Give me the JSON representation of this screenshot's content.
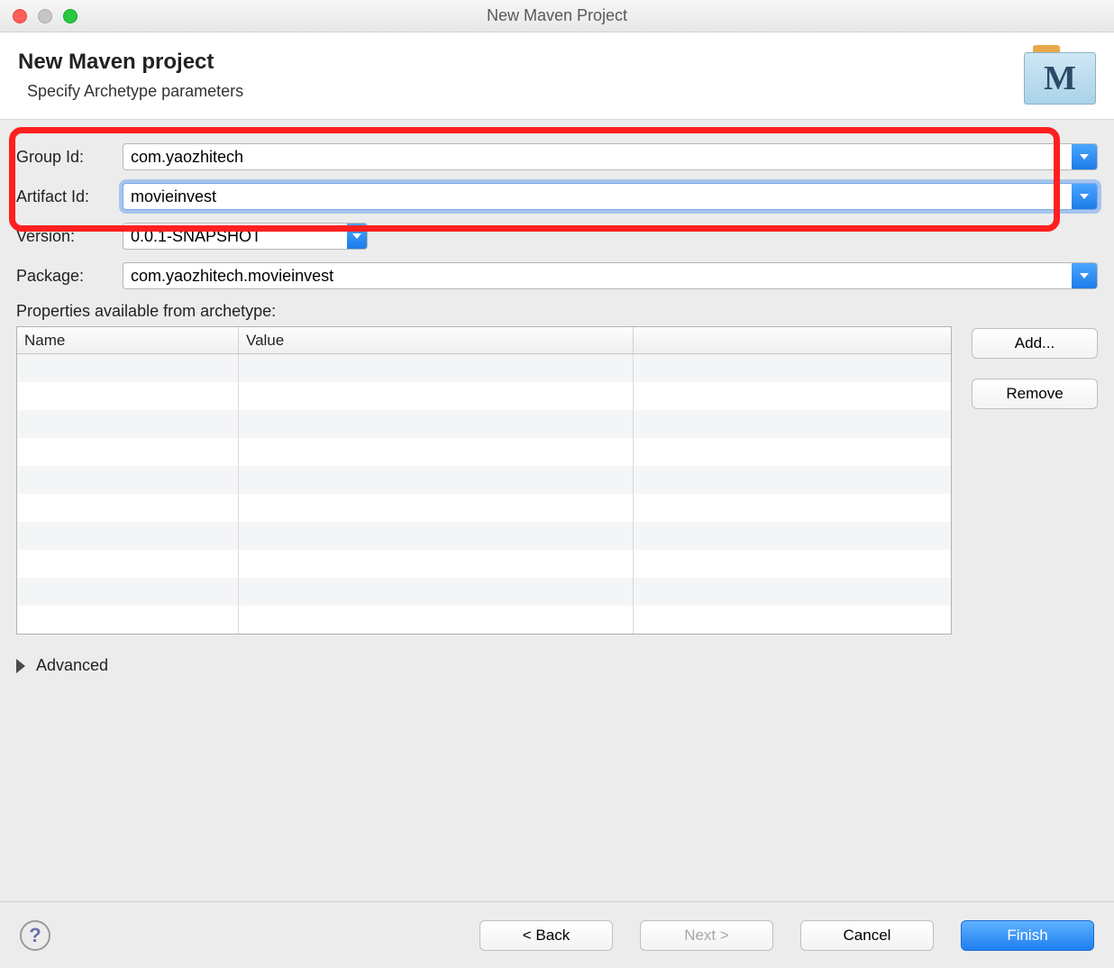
{
  "window": {
    "title": "New Maven Project"
  },
  "header": {
    "title": "New Maven project",
    "subtitle": "Specify Archetype parameters",
    "icon_letter": "M"
  },
  "fields": {
    "group_label": "Group Id:",
    "group_value": "com.yaozhitech",
    "artifact_label": "Artifact Id:",
    "artifact_value": "movieinvest",
    "version_label": "Version:",
    "version_value": "0.0.1-SNAPSHOT",
    "package_label": "Package:",
    "package_value": "com.yaozhitech.movieinvest"
  },
  "properties": {
    "label": "Properties available from archetype:",
    "col_name": "Name",
    "col_value": "Value",
    "add_label": "Add...",
    "remove_label": "Remove"
  },
  "advanced": {
    "label": "Advanced"
  },
  "footer": {
    "help_glyph": "?",
    "back": "< Back",
    "next": "Next >",
    "cancel": "Cancel",
    "finish": "Finish"
  }
}
